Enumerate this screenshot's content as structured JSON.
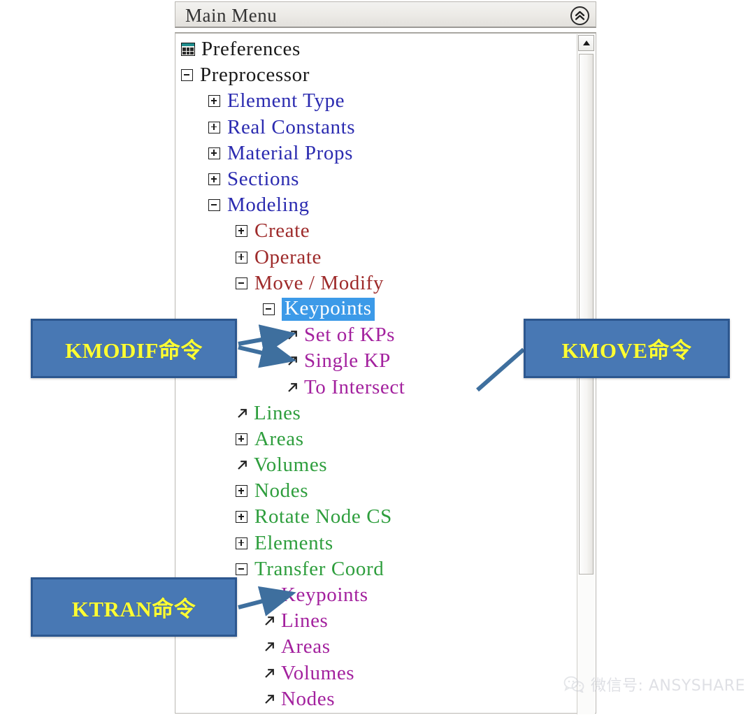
{
  "panel": {
    "title": "Main Menu",
    "collapse_icon": "double-chevron-up-icon",
    "scroll_up_icon": "triangle-up-icon"
  },
  "colors": {
    "level_root": "#1a1a1a",
    "level_blue": "#2b2bb0",
    "level_maroon": "#9e2b2b",
    "level_green": "#2e9e3d",
    "level_magenta": "#a3219e",
    "highlight_bg": "#3c9ae8",
    "highlight_fg": "#ffffff",
    "callout_bg": "#4878b4",
    "callout_border": "#2d578f",
    "callout_text": "#ffff33"
  },
  "tree": [
    {
      "label": "Preferences",
      "indent": 0,
      "icon": "preferences-dialog-icon",
      "color": "#1a1a1a"
    },
    {
      "label": "Preprocessor",
      "indent": 0,
      "icon": "minus-toggle-icon",
      "color": "#1a1a1a"
    },
    {
      "label": "Element Type",
      "indent": 2,
      "icon": "plus-toggle-icon",
      "color": "#2b2bb0"
    },
    {
      "label": "Real Constants",
      "indent": 2,
      "icon": "plus-toggle-icon",
      "color": "#2b2bb0"
    },
    {
      "label": "Material Props",
      "indent": 2,
      "icon": "plus-toggle-icon",
      "color": "#2b2bb0"
    },
    {
      "label": "Sections",
      "indent": 2,
      "icon": "plus-toggle-icon",
      "color": "#2b2bb0"
    },
    {
      "label": "Modeling",
      "indent": 2,
      "icon": "minus-toggle-icon",
      "color": "#2b2bb0"
    },
    {
      "label": "Create",
      "indent": 3,
      "icon": "plus-toggle-icon",
      "color": "#9e2b2b"
    },
    {
      "label": "Operate",
      "indent": 3,
      "icon": "plus-toggle-icon",
      "color": "#9e2b2b"
    },
    {
      "label": "Move / Modify",
      "indent": 3,
      "icon": "minus-toggle-icon",
      "color": "#9e2b2b"
    },
    {
      "label": "Keypoints",
      "indent": 4,
      "icon": "minus-toggle-icon",
      "color": "#ffffff",
      "highlighted": true
    },
    {
      "label": "Set of KPs",
      "indent": 5,
      "icon": "arrow-leaf-icon",
      "color": "#a3219e"
    },
    {
      "label": "Single KP",
      "indent": 5,
      "icon": "arrow-leaf-icon",
      "color": "#a3219e"
    },
    {
      "label": "To Intersect",
      "indent": 5,
      "icon": "arrow-leaf-icon",
      "color": "#a3219e"
    },
    {
      "label": "Lines",
      "indent": 3,
      "icon": "arrow-leaf-icon",
      "color": "#2e9e3d"
    },
    {
      "label": "Areas",
      "indent": 3,
      "icon": "plus-toggle-icon",
      "color": "#2e9e3d"
    },
    {
      "label": "Volumes",
      "indent": 3,
      "icon": "arrow-leaf-icon",
      "color": "#2e9e3d"
    },
    {
      "label": "Nodes",
      "indent": 3,
      "icon": "plus-toggle-icon",
      "color": "#2e9e3d"
    },
    {
      "label": "Rotate Node CS",
      "indent": 3,
      "icon": "plus-toggle-icon",
      "color": "#2e9e3d"
    },
    {
      "label": "Elements",
      "indent": 3,
      "icon": "plus-toggle-icon",
      "color": "#2e9e3d"
    },
    {
      "label": "Transfer Coord",
      "indent": 3,
      "icon": "minus-toggle-icon",
      "color": "#2e9e3d"
    },
    {
      "label": "Keypoints",
      "indent": 4,
      "icon": "arrow-leaf-icon",
      "color": "#a3219e"
    },
    {
      "label": "Lines",
      "indent": 4,
      "icon": "arrow-leaf-icon",
      "color": "#a3219e"
    },
    {
      "label": "Areas",
      "indent": 4,
      "icon": "arrow-leaf-icon",
      "color": "#a3219e"
    },
    {
      "label": "Volumes",
      "indent": 4,
      "icon": "arrow-leaf-icon",
      "color": "#a3219e"
    },
    {
      "label": "Nodes",
      "indent": 4,
      "icon": "arrow-leaf-icon",
      "color": "#a3219e"
    }
  ],
  "callouts": {
    "kmodif": "KMODIF命令",
    "kmove": "KMOVE命令",
    "ktran": "KTRAN命令"
  },
  "watermark": {
    "icon": "wechat-icon",
    "text": "微信号: ANSYSHARE"
  }
}
